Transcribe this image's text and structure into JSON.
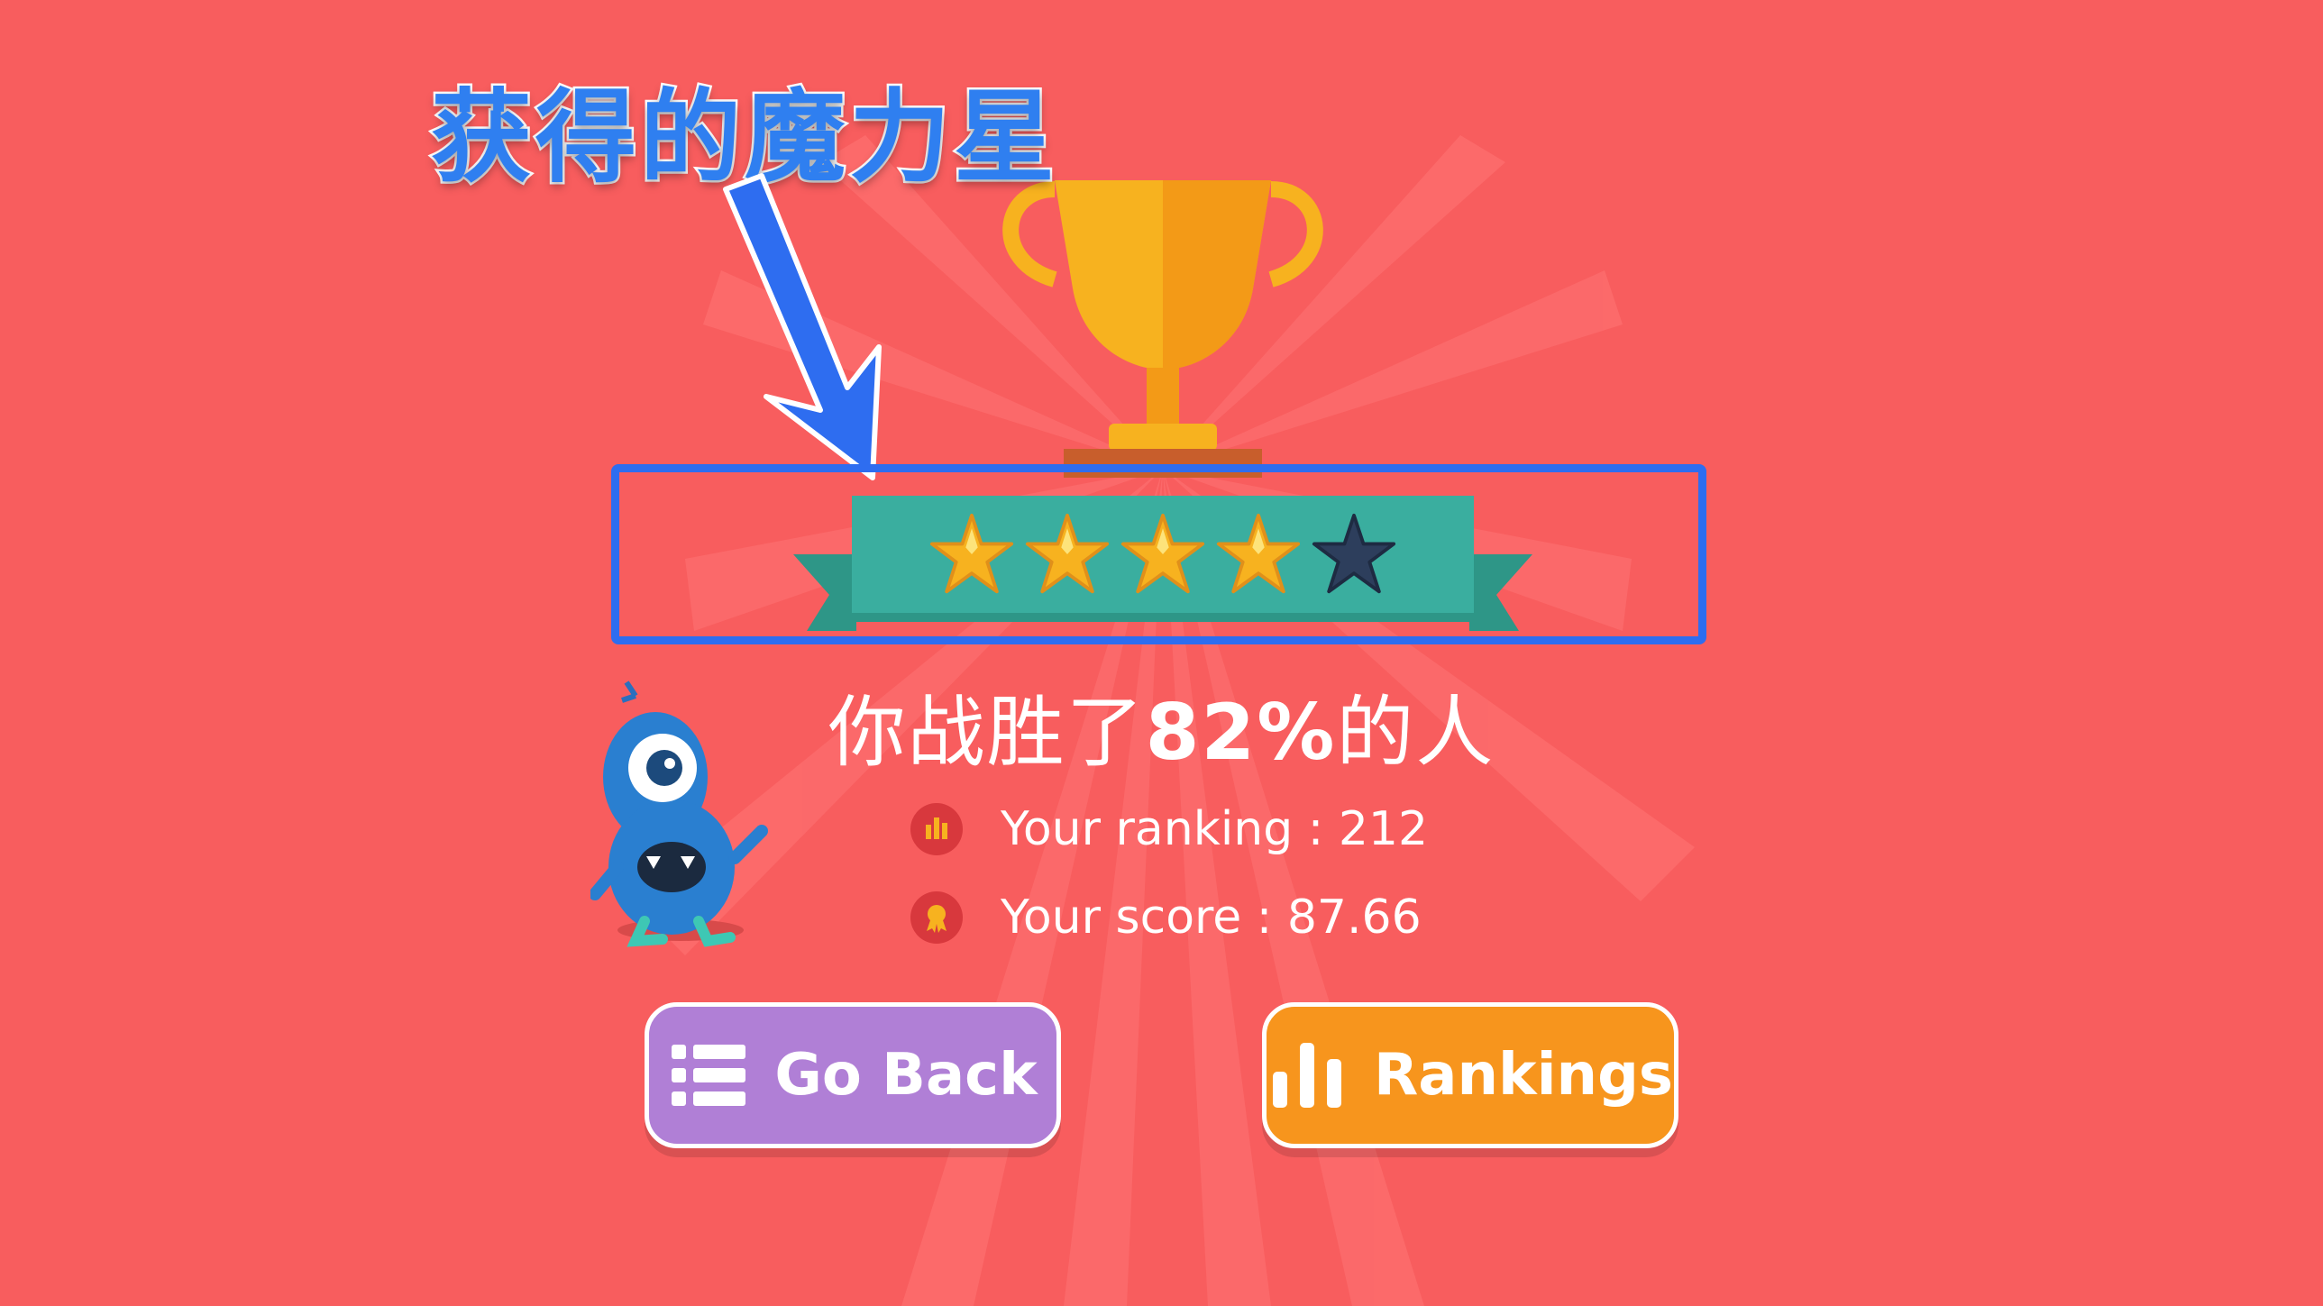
{
  "annotation": {
    "label": "获得的魔力星",
    "frame_color": "#2e6df0"
  },
  "result": {
    "stars": {
      "earned": 4,
      "total": 5
    },
    "defeat_prefix": "你战胜了",
    "defeat_percent": "82%",
    "defeat_suffix": "的人"
  },
  "stats": {
    "ranking": "Your ranking : 212",
    "score": "Your score : 87.66"
  },
  "buttons": {
    "go_back": "Go Back",
    "rankings": "Rankings"
  },
  "colors": {
    "background": "#f85d5e",
    "ribbon": "#3aae9f",
    "star_gold": "#f7b21f",
    "star_empty": "#2d3e5c",
    "go_back": "#b07fd6",
    "rankings": "#f7951d"
  },
  "icons": {
    "ranking": "bar-chart-icon",
    "score": "medal-icon",
    "go_back": "list-icon",
    "rankings": "bars-icon",
    "trophy": "trophy-icon"
  }
}
